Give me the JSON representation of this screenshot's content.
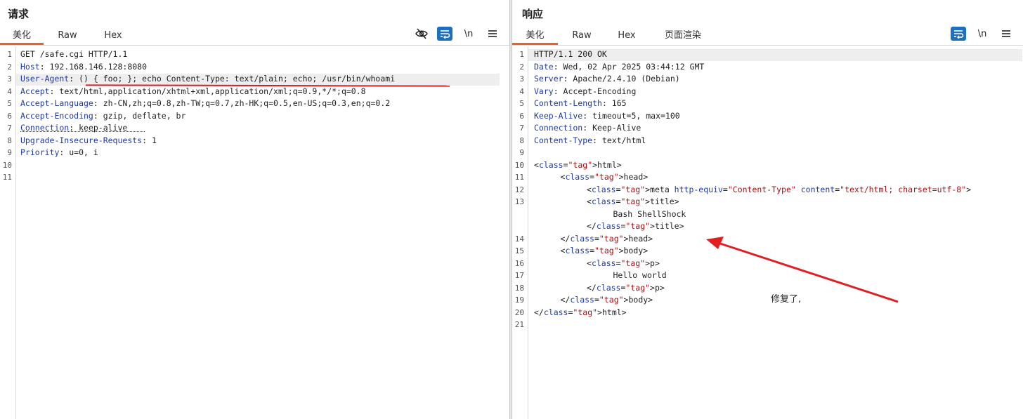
{
  "request": {
    "title": "请求",
    "tabs": [
      "美化",
      "Raw",
      "Hex"
    ],
    "tools": [
      "eye-off-icon",
      "wrap-icon",
      "newline-icon",
      "menu-icon"
    ],
    "newline_label": "\\n",
    "lines": [
      {
        "num": "1",
        "key": "",
        "val": "GET /safe.cgi HTTP/1.1"
      },
      {
        "num": "2",
        "key": "Host",
        "val": ": 192.168.146.128:8080"
      },
      {
        "num": "3",
        "key": "User-Agent",
        "val": ": () { foo; }; echo Content-Type: text/plain; echo; /usr/bin/whoami"
      },
      {
        "num": "4",
        "key": "Accept",
        "val": ": text/html,application/xhtml+xml,application/xml;q=0.9,*/*;q=0.8"
      },
      {
        "num": "5",
        "key": "Accept-Language",
        "val": ": zh-CN,zh;q=0.8,zh-TW;q=0.7,zh-HK;q=0.5,en-US;q=0.3,en;q=0.2"
      },
      {
        "num": "6",
        "key": "Accept-Encoding",
        "val": ": gzip, deflate, br"
      },
      {
        "num": "7",
        "key": "Connection",
        "val": ": keep-alive"
      },
      {
        "num": "8",
        "key": "Upgrade-Insecure-Requests",
        "val": ": 1"
      },
      {
        "num": "9",
        "key": "Priority",
        "val": ": u=0, i"
      },
      {
        "num": "10",
        "key": "",
        "val": ""
      },
      {
        "num": "11",
        "key": "",
        "val": ""
      }
    ]
  },
  "response": {
    "title": "响应",
    "tabs": [
      "美化",
      "Raw",
      "Hex",
      "页面渲染"
    ],
    "tools": [
      "wrap-icon",
      "newline-icon",
      "menu-icon"
    ],
    "newline_label": "\\n",
    "header_lines": [
      {
        "num": "1",
        "key": "",
        "val": "HTTP/1.1 200 OK"
      },
      {
        "num": "2",
        "key": "Date",
        "val": ": Wed, 02 Apr 2025 03:44:12 GMT"
      },
      {
        "num": "3",
        "key": "Server",
        "val": ": Apache/2.4.10 (Debian)"
      },
      {
        "num": "4",
        "key": "Vary",
        "val": ": Accept-Encoding"
      },
      {
        "num": "5",
        "key": "Content-Length",
        "val": ": 165"
      },
      {
        "num": "6",
        "key": "Keep-Alive",
        "val": ": timeout=5, max=100"
      },
      {
        "num": "7",
        "key": "Connection",
        "val": ": Keep-Alive"
      },
      {
        "num": "8",
        "key": "Content-Type",
        "val": ": text/html"
      },
      {
        "num": "9",
        "key": "",
        "val": ""
      }
    ],
    "body_lines": [
      {
        "num": "10",
        "indent": 0,
        "text": "<html>"
      },
      {
        "num": "11",
        "indent": 1,
        "text": "<head>"
      },
      {
        "num": "12",
        "indent": 2,
        "text": "<meta http-equiv=\"Content-Type\" content=\"text/html; charset=utf-8\">"
      },
      {
        "num": "13",
        "indent": 2,
        "text": "<title>"
      },
      {
        "num": "",
        "indent": 3,
        "text": "Bash ShellShock"
      },
      {
        "num": "",
        "indent": 2,
        "text": "</title>"
      },
      {
        "num": "14",
        "indent": 1,
        "text": "</head>"
      },
      {
        "num": "15",
        "indent": 1,
        "text": "<body>"
      },
      {
        "num": "16",
        "indent": 2,
        "text": "<p>"
      },
      {
        "num": "17",
        "indent": 3,
        "text": "Hello world"
      },
      {
        "num": "18",
        "indent": 2,
        "text": "</p>"
      },
      {
        "num": "19",
        "indent": 1,
        "text": "</body>"
      },
      {
        "num": "20",
        "indent": 0,
        "text": "</html>"
      },
      {
        "num": "21",
        "indent": 0,
        "text": ""
      }
    ]
  },
  "annotation": {
    "text": "修复了,",
    "arrow_color": "#e02020",
    "underline_color": "#d42020"
  },
  "colors": {
    "accent_tab": "#e8602c",
    "selected_tool": "#1f6fbf",
    "header_key": "#1f3aa0",
    "html_tag": "#881280",
    "html_string": "#a31515"
  }
}
